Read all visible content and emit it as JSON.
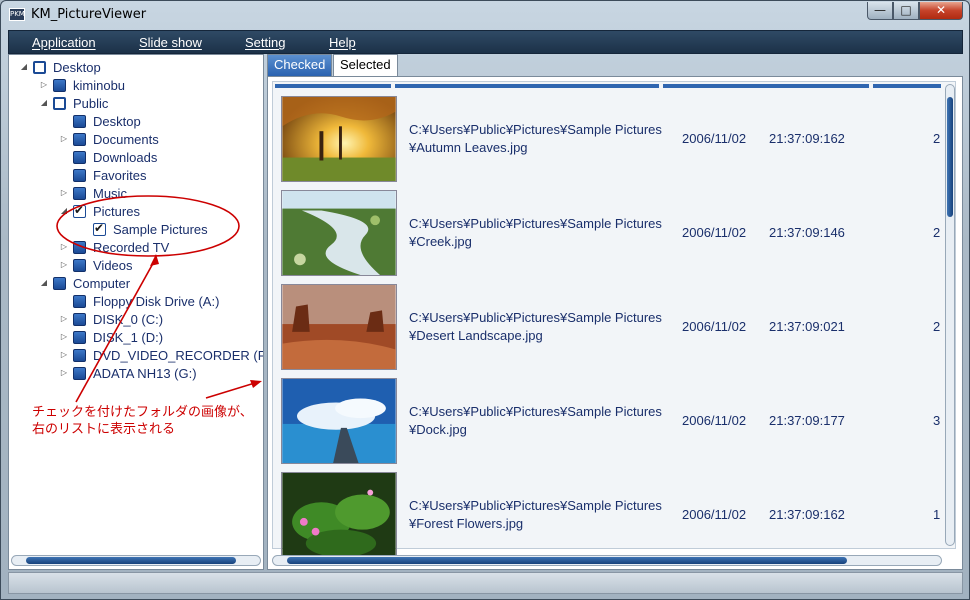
{
  "window": {
    "title": "KM_PictureViewer",
    "app_icon_text": "PKM",
    "min_symbol": "—",
    "max_symbol": "□",
    "close_symbol": "✕"
  },
  "menu": [
    "Application",
    "Slide show",
    "Setting",
    "Help"
  ],
  "tree": [
    {
      "label": "Desktop",
      "arrow": "◢",
      "box": "hollow"
    },
    {
      "label": "kiminobu",
      "arrow": "▷",
      "box": "filled"
    },
    {
      "label": "Public",
      "arrow": "◢",
      "box": "hollow"
    },
    {
      "label": "Desktop",
      "arrow": "",
      "box": "filled"
    },
    {
      "label": "Documents",
      "arrow": "▷",
      "box": "filled"
    },
    {
      "label": "Downloads",
      "arrow": "",
      "box": "filled"
    },
    {
      "label": "Favorites",
      "arrow": "",
      "box": "filled"
    },
    {
      "label": "Music",
      "arrow": "▷",
      "box": "filled"
    },
    {
      "label": "Pictures",
      "arrow": "◢",
      "box": "checked"
    },
    {
      "label": "Sample Pictures",
      "arrow": "",
      "box": "checked"
    },
    {
      "label": "Recorded TV",
      "arrow": "▷",
      "box": "filled"
    },
    {
      "label": "Videos",
      "arrow": "▷",
      "box": "filled"
    },
    {
      "label": "Computer",
      "arrow": "◢",
      "box": "filled"
    },
    {
      "label": "Floppy Disk Drive (A:)",
      "arrow": "",
      "box": "filled"
    },
    {
      "label": "DISK_0 (C:)",
      "arrow": "▷",
      "box": "filled"
    },
    {
      "label": "DISK_1 (D:)",
      "arrow": "▷",
      "box": "filled"
    },
    {
      "label": "DVD_VIDEO_RECORDER (F:",
      "arrow": "▷",
      "box": "filled"
    },
    {
      "label": "ADATA NH13 (G:)",
      "arrow": "▷",
      "box": "filled"
    }
  ],
  "tabs": {
    "checked": "Checked",
    "selected": "Selected"
  },
  "files": [
    {
      "path1": "C:¥Users¥Public¥Pictures¥Sample Pictures",
      "path2": "¥Autumn Leaves.jpg",
      "date": "2006/11/02",
      "time": "21:37:09:162",
      "num": "2",
      "thumb": "autumn"
    },
    {
      "path1": "C:¥Users¥Public¥Pictures¥Sample Pictures",
      "path2": "¥Creek.jpg",
      "date": "2006/11/02",
      "time": "21:37:09:146",
      "num": "2",
      "thumb": "creek"
    },
    {
      "path1": "C:¥Users¥Public¥Pictures¥Sample Pictures",
      "path2": "¥Desert Landscape.jpg",
      "date": "2006/11/02",
      "time": "21:37:09:021",
      "num": "2",
      "thumb": "desert"
    },
    {
      "path1": "C:¥Users¥Public¥Pictures¥Sample Pictures",
      "path2": "¥Dock.jpg",
      "date": "2006/11/02",
      "time": "21:37:09:177",
      "num": "3",
      "thumb": "dock"
    },
    {
      "path1": "C:¥Users¥Public¥Pictures¥Sample Pictures",
      "path2": "¥Forest Flowers.jpg",
      "date": "2006/11/02",
      "time": "21:37:09:162",
      "num": "1",
      "thumb": "forest"
    }
  ],
  "annotation": {
    "line1": "チェックを付けたフォルダの画像が、",
    "line2": "右のリストに表示される",
    "color": "#cc0000"
  }
}
